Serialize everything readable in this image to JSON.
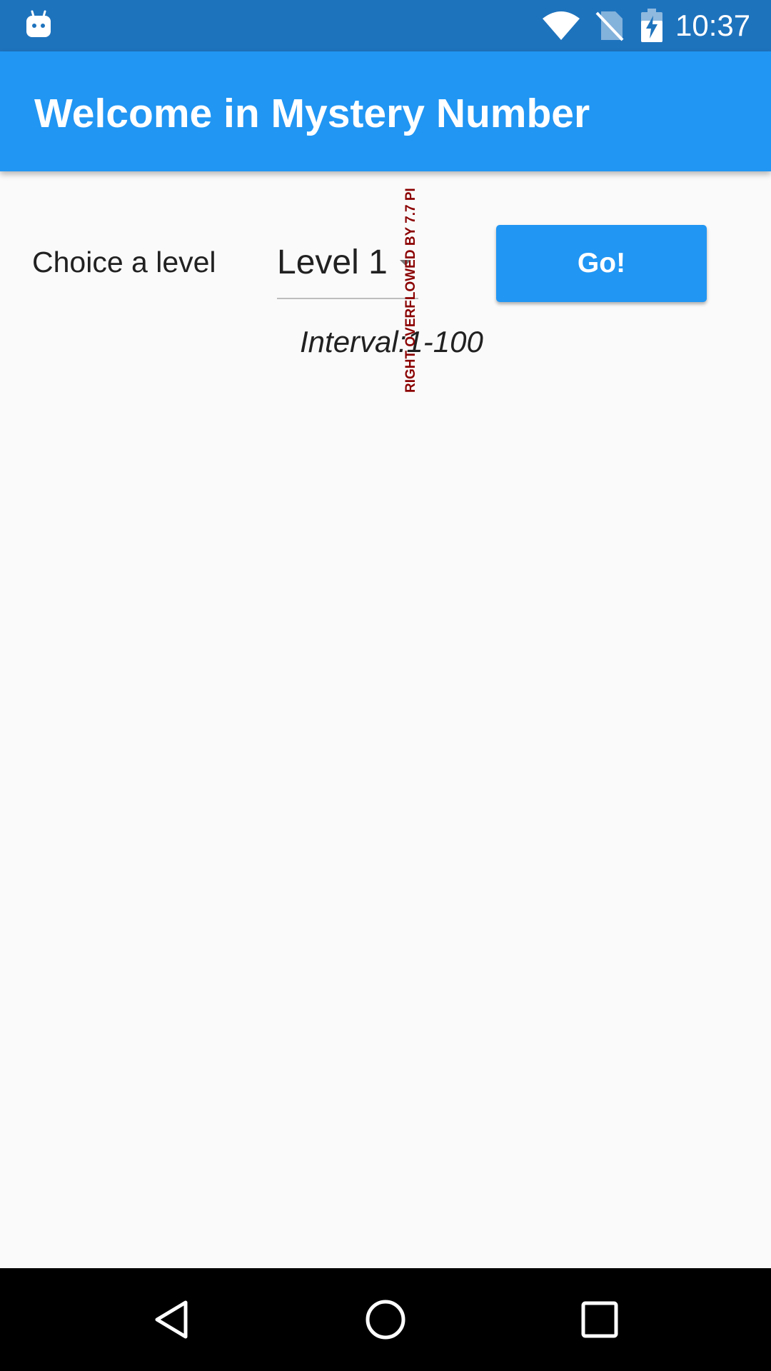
{
  "status_bar": {
    "time": "10:37",
    "icons": [
      "android-robot-icon",
      "wifi-icon",
      "no-sim-icon",
      "battery-charging-icon"
    ]
  },
  "app_bar": {
    "title": "Welcome in Mystery Number"
  },
  "main": {
    "level_label": "Choice a level",
    "level_dropdown": {
      "selected": "Level 1"
    },
    "go_button_label": "Go!",
    "interval_text": "Interval:1-100",
    "overflow_warning": "RIGHT OVERFLOWED BY 7.7 PI"
  },
  "nav_bar": {
    "icons": [
      "back-icon",
      "home-icon",
      "recents-icon"
    ]
  },
  "colors": {
    "status_bar": "#1E73BD",
    "app_bar": "#2196F3",
    "button": "#2196F3",
    "background": "#FAFAFA",
    "overflow_text": "#8B0000"
  }
}
